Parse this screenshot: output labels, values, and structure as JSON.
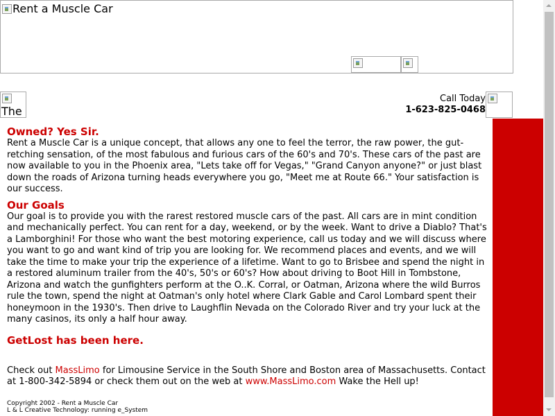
{
  "banner": {
    "alt": "Rent a Muscle Car",
    "image_icon": "broken-image-icon"
  },
  "logo": {
    "alt": "The"
  },
  "call": {
    "label": "Call Today",
    "phone": "1-623-825-0468"
  },
  "colors": {
    "accent": "#cc0000",
    "redbar": "#cc0000"
  },
  "sections": {
    "owned_heading": "Owned? Yes Sir.",
    "owned_text": "Rent a Muscle Car is a unique concept, that allows any one to feel the terror, the raw power, the gut-retching sensation, of the most fabulous and furious cars of the 60's and 70's. These cars of the past are now available to you in the Phoenix area, \"Lets take off for Vegas,\" \"Grand Canyon anyone?\" or just blast down the roads of Arizona turning heads everywhere you go, \"Meet me at Route 66.\" Your satisfaction is our success.",
    "goals_heading": "Our Goals",
    "goals_text": "Our goal is to provide you with the rarest restored muscle cars of the past. All cars are in mint condition and mechanically perfect. You can rent for a day, weekend, or by the week. Want to drive a Diablo? That's a Lamborghini! For those who want the best motoring experience, call us today and we will discuss where you want to go and want kind of trip you are looking for. We recommend places and events, and we will take the time to make your trip the experience of a lifetime. Want to go to Brisbee and spend the night in a restored aluminum trailer from the 40's, 50's or 60's? How about driving to Boot Hill in Tombstone, Arizona and watch the gunfighters perform at the O..K. Corral, or Oatman, Arizona where the wild Burros rule the town, spend the night at Oatman's only hotel where Clark Gable and Carol Lombard spent their honeymoon in the 1930's. Then drive to Laughflin Nevada on the Colorado River and try your luck at the many casinos, its only a half hour away.",
    "getlost_heading": "GetLost has been here."
  },
  "masslimo": {
    "prefix": "Check out ",
    "link1": "MassLimo",
    "middle": " for Limousine Service in the South Shore and Boston area of Massachusetts. Contact at 1-800-342-5894 or check them out on the web at ",
    "link2": "www.MassLimo.com",
    "suffix": " Wake the Hell up!"
  },
  "footer": {
    "copyright": "Copyright 2002 - Rent a Muscle Car",
    "credit": "L & L Creative Technology: running e_System"
  }
}
